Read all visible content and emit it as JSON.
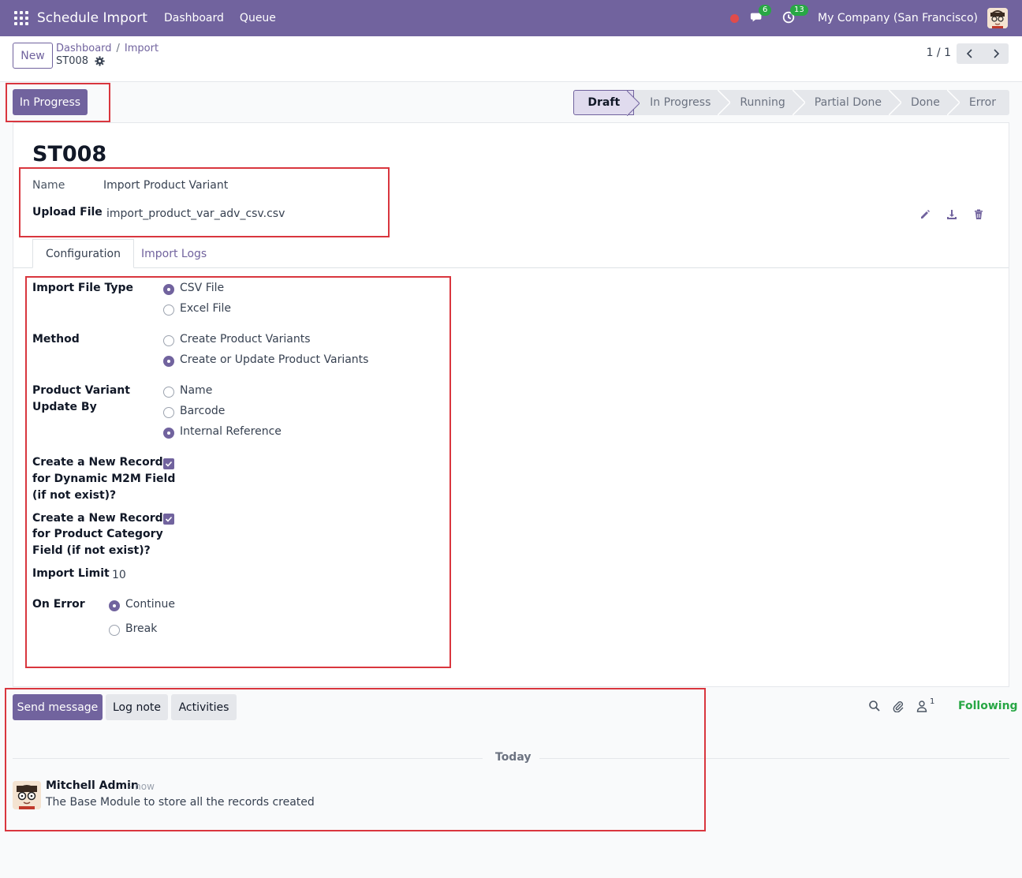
{
  "navbar": {
    "app_title": "Schedule Import",
    "links": [
      "Dashboard",
      "Queue"
    ],
    "messages_badge": "6",
    "activities_badge": "13",
    "company": "My Company (San Francisco)"
  },
  "control": {
    "new_label": "New",
    "breadcrumb": [
      "Dashboard",
      "Import"
    ],
    "record_name": "ST008",
    "pager": "1 / 1"
  },
  "status": {
    "action_button": "In Progress",
    "stages": [
      "Draft",
      "In Progress",
      "Running",
      "Partial Done",
      "Done",
      "Error"
    ],
    "active_stage": "Draft"
  },
  "form": {
    "title": "ST008",
    "name_label": "Name",
    "name_value": "Import Product Variant",
    "upload_label": "Upload File",
    "upload_value": "import_product_var_adv_csv.csv",
    "tabs": [
      "Configuration",
      "Import Logs"
    ],
    "import_file_type": {
      "label": "Import File Type",
      "options": [
        "CSV File",
        "Excel File"
      ],
      "selected": "CSV File"
    },
    "method": {
      "label": "Method",
      "options": [
        "Create Product Variants",
        "Create or Update Product Variants"
      ],
      "selected": "Create or Update Product Variants"
    },
    "update_by": {
      "label_line1": "Product Variant",
      "label_line2": "Update By",
      "options": [
        "Name",
        "Barcode",
        "Internal Reference"
      ],
      "selected": "Internal Reference"
    },
    "m2m_field": {
      "label_line1": "Create a New Record",
      "label_line2": "for Dynamic M2M Field",
      "label_line3": "(if not exist)?",
      "checked": true
    },
    "category_field": {
      "label_line1": "Create a New Record",
      "label_line2": "for Product Category",
      "label_line3": "Field (if not exist)?",
      "checked": true
    },
    "import_limit": {
      "label": "Import Limit",
      "value": "10"
    },
    "on_error": {
      "label": "On Error",
      "options": [
        "Continue",
        "Break"
      ],
      "selected": "Continue"
    }
  },
  "chatter": {
    "send_message": "Send message",
    "log_note": "Log note",
    "activities": "Activities",
    "followers_count": "1",
    "following": "Following",
    "date_separator": "Today",
    "message": {
      "author": "Mitchell Admin",
      "time": "- now",
      "body": "The Base Module to store all the records created"
    }
  },
  "colors": {
    "brand": "#71639e",
    "highlight": "#d9363e",
    "following": "#28a745"
  }
}
